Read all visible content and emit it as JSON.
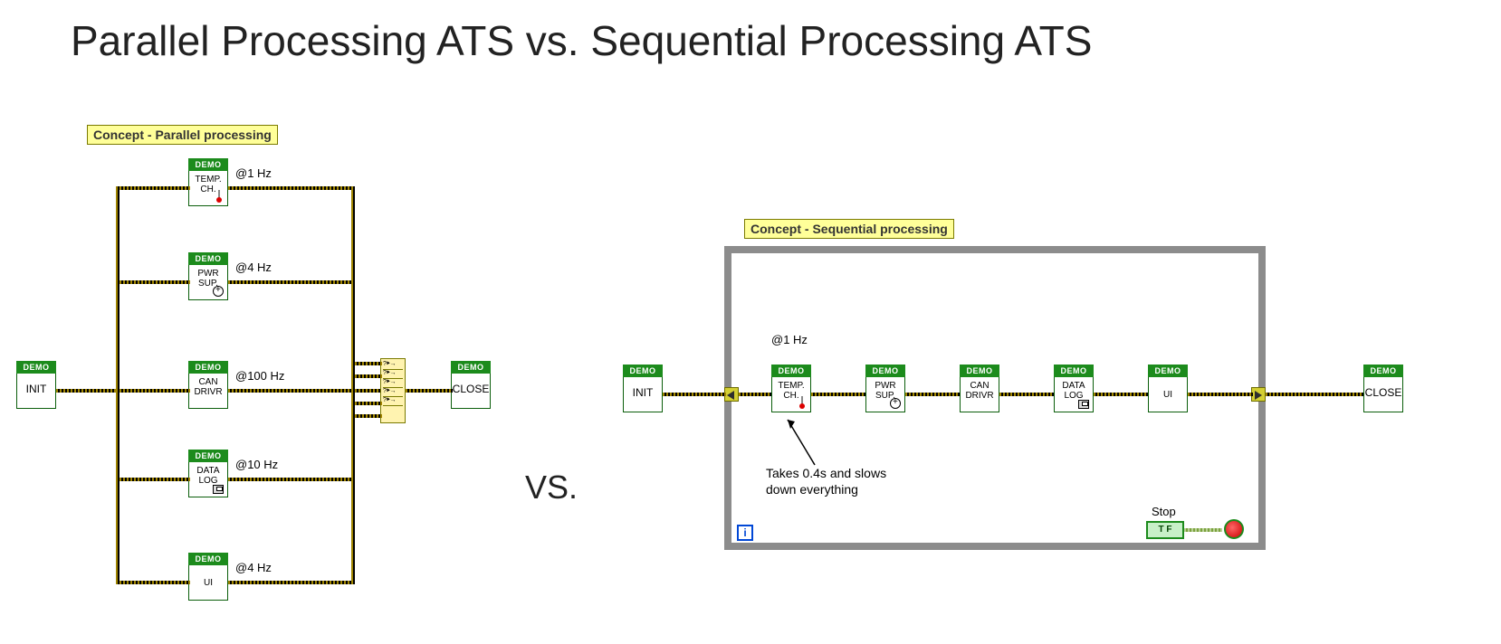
{
  "title": "Parallel Processing ATS vs. Sequential Processing ATS",
  "vs_label": "VS.",
  "parallel": {
    "caption": "Concept - Parallel processing",
    "init": {
      "demo": "DEMO",
      "label": "INIT"
    },
    "close": {
      "demo": "DEMO",
      "label": "CLOSE"
    },
    "branches": [
      {
        "demo": "DEMO",
        "label": "TEMP.\nCH.",
        "rate": "@1 Hz",
        "icon": "thermometer"
      },
      {
        "demo": "DEMO",
        "label": "PWR\nSUP.",
        "rate": "@4 Hz",
        "icon": "plus-circle"
      },
      {
        "demo": "DEMO",
        "label": "CAN\nDRIVR",
        "rate": "@100 Hz",
        "icon": ""
      },
      {
        "demo": "DEMO",
        "label": "DATA\nLOG",
        "rate": "@10 Hz",
        "icon": "disk"
      },
      {
        "demo": "DEMO",
        "label": "UI",
        "rate": "@4 Hz",
        "icon": ""
      }
    ]
  },
  "sequential": {
    "caption": "Concept - Sequential processing",
    "init": {
      "demo": "DEMO",
      "label": "INIT"
    },
    "close": {
      "demo": "DEMO",
      "label": "CLOSE"
    },
    "rate_label": "@1 Hz",
    "nodes": [
      {
        "demo": "DEMO",
        "label": "TEMP.\nCH.",
        "icon": "thermometer"
      },
      {
        "demo": "DEMO",
        "label": "PWR\nSUP.",
        "icon": "plus-circle"
      },
      {
        "demo": "DEMO",
        "label": "CAN\nDRIVR",
        "icon": ""
      },
      {
        "demo": "DEMO",
        "label": "DATA\nLOG",
        "icon": "disk"
      },
      {
        "demo": "DEMO",
        "label": "UI",
        "icon": ""
      }
    ],
    "annotation": "Takes 0.4s and slows\ndown everything",
    "stop": {
      "label": "Stop",
      "tf": "T F"
    },
    "i_terminal": "i"
  }
}
